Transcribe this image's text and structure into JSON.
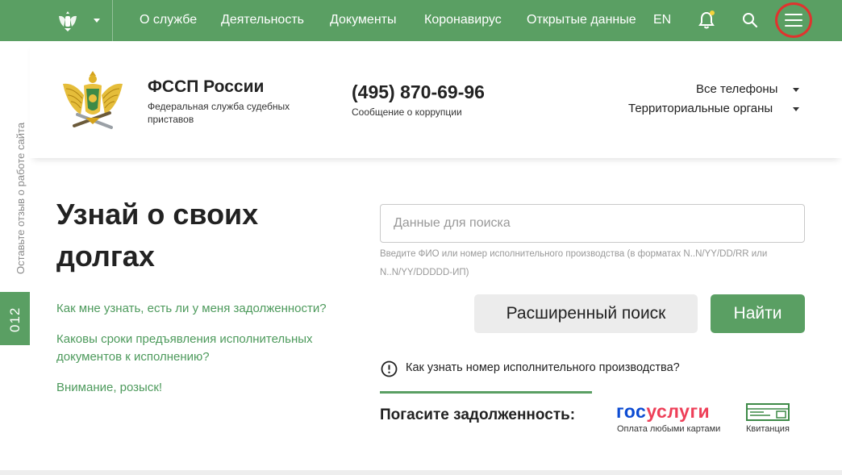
{
  "nav": {
    "items": [
      "О службе",
      "Деятельность",
      "Документы",
      "Коронавирус",
      "Открытые данные",
      "EN"
    ],
    "icons": [
      "emblem-icon",
      "chevron-down-icon",
      "bell-icon",
      "search-icon",
      "menu-icon"
    ],
    "colors": {
      "bar": "#5a9f63",
      "highlight": "#e0332e",
      "notification": "#f5d33a"
    }
  },
  "side": {
    "feedback": "Оставьте отзыв о работе сайта",
    "code": "012"
  },
  "header": {
    "org_name": "ФССП России",
    "org_sub": "Федеральная служба судебных приставов",
    "phone": "(495) 870-69-96",
    "corruption": "Сообщение о коррупции",
    "all_phones": "Все телефоны",
    "territorial": "Территориальные органы"
  },
  "main": {
    "hero": "Узнай о своих долгах",
    "faq": [
      "Как мне узнать, есть ли у меня задолженности?",
      "Каковы сроки предъявления исполнительных документов к исполнению?",
      "Внимание, розыск!"
    ],
    "search_placeholder": "Данные для поиска",
    "search_value": "",
    "hint": "Введите ФИО или номер исполнительного производства (в форматах N..N/YY/DD/RR или N..N/YY/DDDDD-ИП)",
    "btn_advanced": "Расширенный поиск",
    "btn_find": "Найти",
    "info_link": "Как узнать номер исполнительного производства?",
    "pay_label": "Погасите задолженность:",
    "gos_part1": "гос",
    "gos_part2": "услуги",
    "gos_sub": "Оплата любыми картами",
    "receipt_sub": "Квитанция"
  }
}
